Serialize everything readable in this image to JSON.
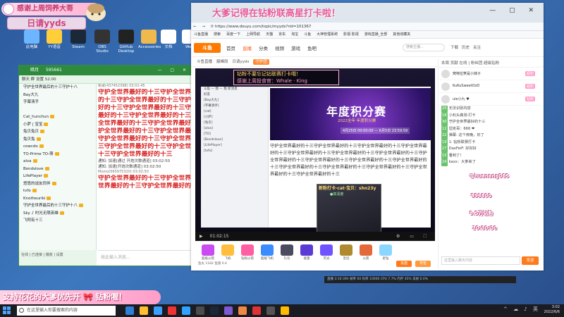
{
  "desktop": {
    "welcome": "感谢上周饲养大哥",
    "streamer_tag": "日请yyds",
    "icons": [
      {
        "label": "此电脑",
        "color": "#6bb6ff"
      },
      {
        "label": "YY语音",
        "color": "#ffcf3a"
      },
      {
        "label": "Steam",
        "color": "#1b2838"
      },
      {
        "label": "OBS Studio",
        "color": "#333333"
      },
      {
        "label": "GitHub Desktop",
        "color": "#222222"
      },
      {
        "label": "Accessories",
        "color": "#f0b94e"
      },
      {
        "label": "文档",
        "color": "#ffffff"
      },
      {
        "label": "Web",
        "color": "#ffffff"
      }
    ]
  },
  "chat": {
    "title": "暗月",
    "group_id": "595661",
    "toolbar": "聊天 群 设置 52:00",
    "members": [
      "守护全世界最后的十三守护十八",
      "Bay大九",
      "字幕清手",
      "",
      "Cat_hunchun",
      "小萨 | 宝宝",
      "兔贝兔贝",
      "兔贝兔",
      "cowcdo",
      "TO-Prime TO-萌",
      "alva",
      "Bondslove",
      "LifePlayer",
      "悠悠的战友同伴",
      "tvfo",
      "Knotheuriki",
      "守护全世界最后的十三守护十八",
      "Sky ♪ 时光无限英雄",
      "飞阿有十三",
      "",
      ""
    ],
    "msg_header": "新歌(437452398) 03:02:45",
    "spam_lines": [
      "守护全世界最好的十三守护全世界最好",
      "的十三守护全世界最好的十三守护全世界最",
      "好的十三守护全世界最好的十三守护全世界",
      "最好的十三守护全世界最好的十三守护全世",
      "全世界最好的十三守护全世界最好的十三守",
      "护全世界最好的十三守护全世界最好的十三",
      "守护全世界最好的十三守护全世界最好的十",
      "三守护全世界最好的十三守护全世界最好的",
      "十三守护全世界最好的十三"
    ],
    "sys_lines": [
      "通知: 加速[通过 开炮次数通道] 03:02:50",
      "通知: 加速[开炮次数通道] 03:02:50"
    ],
    "msg_header2": "Momo(565975320) 03:02:50",
    "spam_lines2": [
      "守护全世界最好的十三守护全世界最好",
      "世界最好的十三守护全世界最好的十三"
    ],
    "composer_placeholder": "按此输入消息...",
    "status": "在线 | 已连接 | 播放 | 设置"
  },
  "browser": {
    "tab_title": "大爹记得在钻粉联高星打卡啦！",
    "url": "https://www.douyu.com/topic/myyds?rid=101367",
    "bookmarks": [
      "斗鱼直播",
      "搜索",
      "百度一下",
      "上网导航",
      "天猫",
      "京东",
      "淘宝",
      "斗鱼",
      "大神管理系统",
      "影视·影视",
      "游戏直播_全部",
      "其他收藏夹"
    ],
    "site_nav": [
      "首页",
      "直播",
      "分类",
      "视频",
      "游戏",
      "鱼吧"
    ],
    "site_search": "搜索主播...",
    "site_links": [
      "下载",
      "历史",
      "关注"
    ],
    "room_tags": [
      "斗鱼直播",
      "巅峰段",
      "日请yyds"
    ],
    "room_badge": "守护团",
    "stream_banner_1": "钻粉不要忘记钻联赛打卡哦！",
    "stream_banner_2": "感谢上周投食官：Whale · King",
    "promo_title": "年度积分赛",
    "promo_year": "2022全年 年度积分赛",
    "promo_dates": "4月25日 00:00:00 — 6月5日 23:59:59",
    "inner_sidebar": [
      "斗鱼 一 我 — 我 新消息",
      "好友",
      "[Bay大九]",
      "[字幕清手]",
      "[cat]",
      "[小萨]",
      "[兔贝]",
      "[alva]",
      "[TO]",
      "[Bondslove]",
      "[LifePlayer]",
      "[tvfo]"
    ],
    "inner_text": "守护全世界最好的十三守护全世界最好的十三守护全世界最好的十三守护全世界最好的十三守护全世界最好的十三守护全世界最好的十三守护全世界最好的十三守护全世界最好的十三守护全世界最好的十三守护全世界最好的十三守护全世界最好的十三守护全世界最好的十三守护全世界最好的十三守护全世界最好的十三守护全世界最好的十三守护全世界最好的十三",
    "cam_label": "新粉打卡·cat·宝贝：shn23y",
    "cam_label2": "●高清度",
    "player_time": "01:02:15",
    "gifts": [
      {
        "label": "超级火箭",
        "color": "#c84cf0"
      },
      {
        "label": "飞机",
        "color": "#ffbe3d"
      },
      {
        "label": "钻粉火箭",
        "color": "#ff5fa2"
      },
      {
        "label": "超级飞机",
        "color": "#3b8cff"
      },
      {
        "label": "礼包",
        "color": "#4c4c60"
      },
      {
        "label": "能量",
        "color": "#5b3bd6"
      },
      {
        "label": "荧光",
        "color": "#6e54ff"
      },
      {
        "label": "皇冠",
        "color": "#b08a2e"
      },
      {
        "label": "火箭",
        "color": "#e3693a"
      },
      {
        "label": "星钻",
        "color": "#8ad6ff"
      }
    ],
    "gift_stats": "鱼丸 1182 鱼翅 0.4",
    "btn_recharge": "充值",
    "btn_pack": "背包",
    "rank_tabs": "本周 贡献 在线 | 粉丝团 超级钻粉",
    "ranks": [
      {
        "name": "窝特拉笑是小妹子",
        "flair": "超粉"
      },
      {
        "name": "KuKuSweetOzD",
        "flair": "超粉"
      },
      {
        "name": "uie小九 ♥",
        "flair": "钻粉"
      }
    ],
    "danmu": [
      {
        "lv": "25",
        "text": "无法识别内容"
      },
      {
        "lv": "18",
        "text": "小石头做测·打卡"
      },
      {
        "lv": "30",
        "text": "守护全世界最好的十三"
      },
      {
        "lv": "12",
        "text": "坦克哥：666 ❤"
      },
      {
        "lv": "22",
        "text": "弹幕: 这个夜晚，好了"
      },
      {
        "lv": "19",
        "text": "1: 钻粉联赛打卡"
      },
      {
        "lv": "27",
        "text": "DaoFeiF: 好好好"
      },
      {
        "lv": "15",
        "text": "看到了！"
      },
      {
        "lv": "24",
        "text": "kaxx：大爹来了"
      }
    ],
    "danmu_input": "这里输入聊天内容",
    "send_label": "发送",
    "fan_lines": [
      "@huanong065",
      "853800",
      "8.5万钻粉",
      "20:00:00"
    ]
  },
  "perf": "直播 3:10:39h  帧率 60  码率 10000  CPU 7.7%  内存 45%  丢帧 0.0%",
  "support_banner": "支持花花的大爹优先开 🎀 钻粉喔！",
  "taskbar": {
    "search_placeholder": "在这里输入你要搜索的内容",
    "time": "3:02",
    "date": "2022/6/6",
    "apps": [
      "#2f7fd8",
      "#ffbf2f",
      "#3aa0ff",
      "#e33",
      "#2fa3ff",
      "#4c4c4c",
      "#1b2838",
      "#7a5bd3",
      "#e84",
      "#d33",
      "#555",
      "#fb0"
    ]
  }
}
